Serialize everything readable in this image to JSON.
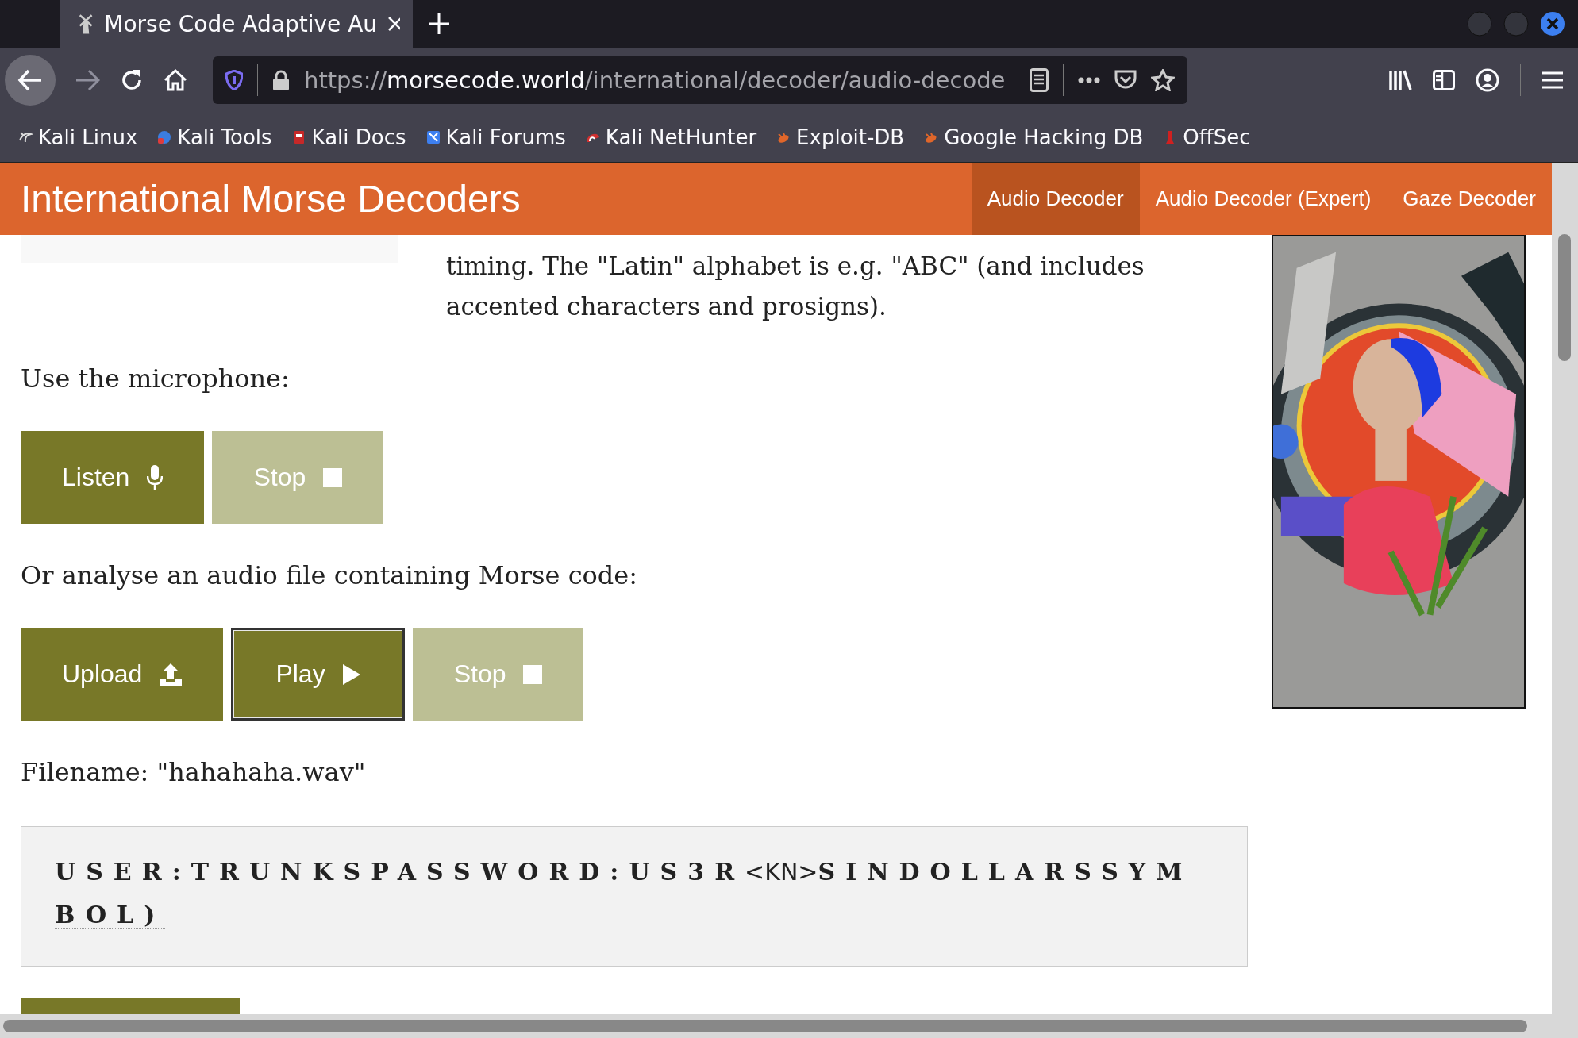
{
  "browser": {
    "tab": {
      "title": "Morse Code Adaptive Au"
    },
    "url": {
      "scheme": "https://",
      "host": "morsecode.world",
      "path": "/international/decoder/audio-decode"
    },
    "bookmarks": [
      "Kali Linux",
      "Kali Tools",
      "Kali Docs",
      "Kali Forums",
      "Kali NetHunter",
      "Exploit-DB",
      "Google Hacking DB",
      "OffSec"
    ]
  },
  "site": {
    "title": "International Morse Decoders",
    "nav": [
      {
        "label": "Audio Decoder",
        "selected": true
      },
      {
        "label": "Audio Decoder (Expert)",
        "selected": false
      },
      {
        "label": "Gaze Decoder",
        "selected": false
      }
    ]
  },
  "intro": "timing. The \"Latin\" alphabet is e.g. \"ABC\" (and includes accented characters and prosigns).",
  "mic_label": "Use the microphone:",
  "mic_buttons": [
    {
      "label": "Listen",
      "kind": "mic",
      "disabled": false,
      "focused": false
    },
    {
      "label": "Stop",
      "kind": "stop",
      "disabled": true,
      "focused": false
    }
  ],
  "file_label": "Or analyse an audio file containing Morse code:",
  "file_buttons": [
    {
      "label": "Upload",
      "kind": "upload",
      "disabled": false,
      "focused": false
    },
    {
      "label": "Play",
      "kind": "play",
      "disabled": false,
      "focused": true
    },
    {
      "label": "Stop",
      "kind": "stop",
      "disabled": true,
      "focused": false
    }
  ],
  "filename": "Filename: \"hahahaha.wav\"",
  "output": [
    {
      "kind": "letters",
      "text": "USER:TRUNKSPASSWORD:US3R"
    },
    {
      "kind": "prosign",
      "text": "<KN>"
    },
    {
      "kind": "letters",
      "text": "SINDOLLARSSYMBOL)"
    }
  ]
}
